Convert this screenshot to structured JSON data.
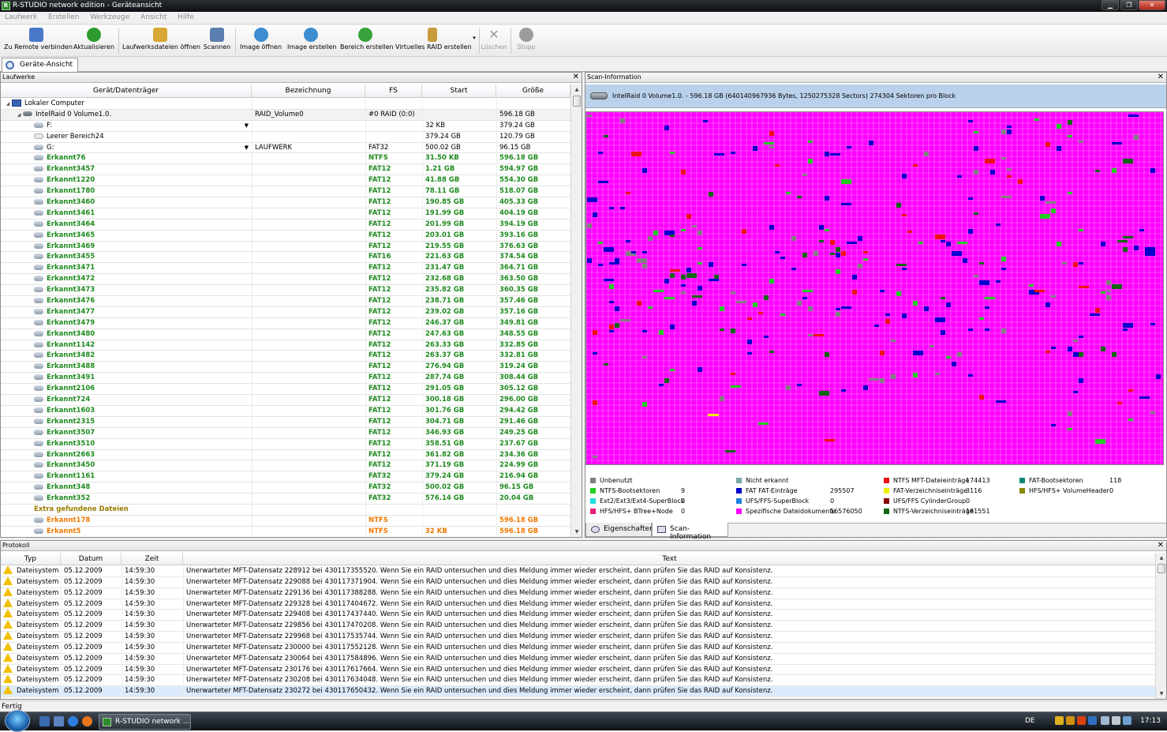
{
  "window": {
    "title": "R-STUDIO network edition - Geräteansicht",
    "buttons": {
      "minimize": "▁",
      "maximize": "❐",
      "close": "✕"
    }
  },
  "menu": [
    "Laufwerk",
    "Erstellen",
    "Werkzeuge",
    "Ansicht",
    "Hilfe"
  ],
  "toolbar": [
    {
      "label": "Zu Remote verbinden",
      "icon": "remote-connect-icon",
      "color": "#4a78c8"
    },
    {
      "label": "Aktualisieren",
      "icon": "refresh-icon",
      "color": "#2e9a2e"
    },
    {
      "label": "Laufwerksdateien öffnen",
      "icon": "open-drive-files-icon",
      "color": "#d8a834"
    },
    {
      "label": "Scannen",
      "icon": "scan-icon",
      "color": "#5a7fb0"
    },
    {
      "label": "Image öffnen",
      "icon": "open-image-icon",
      "color": "#3c8ed0"
    },
    {
      "label": "Image erstellen",
      "icon": "create-image-icon",
      "color": "#3c8ed0"
    },
    {
      "label": "Bereich erstellen",
      "icon": "create-region-icon",
      "color": "#3aa23a"
    },
    {
      "label": "Virtuelles RAID erstellen",
      "icon": "virtual-raid-icon",
      "color": "#c89c3c"
    },
    {
      "label": "Löschen",
      "icon": "delete-icon",
      "color": "#9c9c9c"
    },
    {
      "label": "Stopp",
      "icon": "stop-icon",
      "color": "#9c9c9c"
    }
  ],
  "doctab": "Geräte-Ansicht",
  "drives": {
    "title": "Laufwerke",
    "columns": [
      "Gerät/Datenträger",
      "Bezeichnung",
      "FS",
      "Start",
      "Größe"
    ],
    "rows": [
      {
        "indent": 0,
        "tri": "◢",
        "icon": "computer-icon",
        "name": "Lokaler Computer",
        "label": "",
        "fs": "",
        "start": "",
        "size": "",
        "style": ""
      },
      {
        "indent": 1,
        "tri": "◢",
        "icon": "disk-icon",
        "name": "IntelRaid 0 Volume1.0.",
        "label": "RAID_Volume0",
        "fs": "#0 RAID (0:0)",
        "start": "",
        "size": "596.18 GB",
        "style": "sel"
      },
      {
        "indent": 2,
        "tri": "",
        "icon": "volume-icon",
        "name": "F:",
        "label": "",
        "fs": "",
        "start": "32 KB",
        "size": "379.24 GB",
        "style": "",
        "dd": true
      },
      {
        "indent": 2,
        "tri": "",
        "icon": "empty-space-icon",
        "name": "Leerer Bereich24",
        "label": "",
        "fs": "",
        "start": "379.24 GB",
        "size": "120.79 GB",
        "style": ""
      },
      {
        "indent": 2,
        "tri": "",
        "icon": "volume-icon",
        "name": "G:",
        "label": "LAUFWERK",
        "fs": "FAT32",
        "start": "500.02 GB",
        "size": "96.15 GB",
        "style": "",
        "dd": true
      },
      {
        "indent": 2,
        "tri": "",
        "icon": "volume-icon",
        "name": "Erkannt76",
        "label": "",
        "fs": "NTFS",
        "start": "31.50 KB",
        "size": "596.18 GB",
        "style": "green"
      },
      {
        "indent": 2,
        "tri": "",
        "icon": "volume-icon",
        "name": "Erkannt3457",
        "label": "",
        "fs": "FAT12",
        "start": "1.21 GB",
        "size": "594.97 GB",
        "style": "green"
      },
      {
        "indent": 2,
        "tri": "",
        "icon": "volume-icon",
        "name": "Erkannt1220",
        "label": "",
        "fs": "FAT12",
        "start": "41.88 GB",
        "size": "554.30 GB",
        "style": "green"
      },
      {
        "indent": 2,
        "tri": "",
        "icon": "volume-icon",
        "name": "Erkannt1780",
        "label": "",
        "fs": "FAT12",
        "start": "78.11 GB",
        "size": "518.07 GB",
        "style": "green"
      },
      {
        "indent": 2,
        "tri": "",
        "icon": "volume-icon",
        "name": "Erkannt3460",
        "label": "",
        "fs": "FAT12",
        "start": "190.85 GB",
        "size": "405.33 GB",
        "style": "green"
      },
      {
        "indent": 2,
        "tri": "",
        "icon": "volume-icon",
        "name": "Erkannt3461",
        "label": "",
        "fs": "FAT12",
        "start": "191.99 GB",
        "size": "404.19 GB",
        "style": "green"
      },
      {
        "indent": 2,
        "tri": "",
        "icon": "volume-icon",
        "name": "Erkannt3464",
        "label": "",
        "fs": "FAT12",
        "start": "201.99 GB",
        "size": "394.19 GB",
        "style": "green"
      },
      {
        "indent": 2,
        "tri": "",
        "icon": "volume-icon",
        "name": "Erkannt3465",
        "label": "",
        "fs": "FAT12",
        "start": "203.01 GB",
        "size": "393.16 GB",
        "style": "green"
      },
      {
        "indent": 2,
        "tri": "",
        "icon": "volume-icon",
        "name": "Erkannt3469",
        "label": "",
        "fs": "FAT12",
        "start": "219.55 GB",
        "size": "376.63 GB",
        "style": "green"
      },
      {
        "indent": 2,
        "tri": "",
        "icon": "volume-icon",
        "name": "Erkannt3455",
        "label": "",
        "fs": "FAT16",
        "start": "221.63 GB",
        "size": "374.54 GB",
        "style": "green"
      },
      {
        "indent": 2,
        "tri": "",
        "icon": "volume-icon",
        "name": "Erkannt3471",
        "label": "",
        "fs": "FAT12",
        "start": "231.47 GB",
        "size": "364.71 GB",
        "style": "green"
      },
      {
        "indent": 2,
        "tri": "",
        "icon": "volume-icon",
        "name": "Erkannt3472",
        "label": "",
        "fs": "FAT12",
        "start": "232.68 GB",
        "size": "363.50 GB",
        "style": "green"
      },
      {
        "indent": 2,
        "tri": "",
        "icon": "volume-icon",
        "name": "Erkannt3473",
        "label": "",
        "fs": "FAT12",
        "start": "235.82 GB",
        "size": "360.35 GB",
        "style": "green"
      },
      {
        "indent": 2,
        "tri": "",
        "icon": "volume-icon",
        "name": "Erkannt3476",
        "label": "",
        "fs": "FAT12",
        "start": "238.71 GB",
        "size": "357.46 GB",
        "style": "green"
      },
      {
        "indent": 2,
        "tri": "",
        "icon": "volume-icon",
        "name": "Erkannt3477",
        "label": "",
        "fs": "FAT12",
        "start": "239.02 GB",
        "size": "357.16 GB",
        "style": "green"
      },
      {
        "indent": 2,
        "tri": "",
        "icon": "volume-icon",
        "name": "Erkannt3479",
        "label": "",
        "fs": "FAT12",
        "start": "246.37 GB",
        "size": "349.81 GB",
        "style": "green"
      },
      {
        "indent": 2,
        "tri": "",
        "icon": "volume-icon",
        "name": "Erkannt3480",
        "label": "",
        "fs": "FAT12",
        "start": "247.63 GB",
        "size": "348.55 GB",
        "style": "green"
      },
      {
        "indent": 2,
        "tri": "",
        "icon": "volume-icon",
        "name": "Erkannt1142",
        "label": "",
        "fs": "FAT12",
        "start": "263.33 GB",
        "size": "332.85 GB",
        "style": "green"
      },
      {
        "indent": 2,
        "tri": "",
        "icon": "volume-icon",
        "name": "Erkannt3482",
        "label": "",
        "fs": "FAT12",
        "start": "263.37 GB",
        "size": "332.81 GB",
        "style": "green"
      },
      {
        "indent": 2,
        "tri": "",
        "icon": "volume-icon",
        "name": "Erkannt3488",
        "label": "",
        "fs": "FAT12",
        "start": "276.94 GB",
        "size": "319.24 GB",
        "style": "green"
      },
      {
        "indent": 2,
        "tri": "",
        "icon": "volume-icon",
        "name": "Erkannt3491",
        "label": "",
        "fs": "FAT12",
        "start": "287.74 GB",
        "size": "308.44 GB",
        "style": "green"
      },
      {
        "indent": 2,
        "tri": "",
        "icon": "volume-icon",
        "name": "Erkannt2106",
        "label": "",
        "fs": "FAT12",
        "start": "291.05 GB",
        "size": "305.12 GB",
        "style": "green"
      },
      {
        "indent": 2,
        "tri": "",
        "icon": "volume-icon",
        "name": "Erkannt724",
        "label": "",
        "fs": "FAT12",
        "start": "300.18 GB",
        "size": "296.00 GB",
        "style": "green"
      },
      {
        "indent": 2,
        "tri": "",
        "icon": "volume-icon",
        "name": "Erkannt1603",
        "label": "",
        "fs": "FAT12",
        "start": "301.76 GB",
        "size": "294.42 GB",
        "style": "green"
      },
      {
        "indent": 2,
        "tri": "",
        "icon": "volume-icon",
        "name": "Erkannt2315",
        "label": "",
        "fs": "FAT12",
        "start": "304.71 GB",
        "size": "291.46 GB",
        "style": "green"
      },
      {
        "indent": 2,
        "tri": "",
        "icon": "volume-icon",
        "name": "Erkannt3507",
        "label": "",
        "fs": "FAT12",
        "start": "346.93 GB",
        "size": "249.25 GB",
        "style": "green"
      },
      {
        "indent": 2,
        "tri": "",
        "icon": "volume-icon",
        "name": "Erkannt3510",
        "label": "",
        "fs": "FAT12",
        "start": "358.51 GB",
        "size": "237.67 GB",
        "style": "green"
      },
      {
        "indent": 2,
        "tri": "",
        "icon": "volume-icon",
        "name": "Erkannt2663",
        "label": "",
        "fs": "FAT12",
        "start": "361.82 GB",
        "size": "234.36 GB",
        "style": "green"
      },
      {
        "indent": 2,
        "tri": "",
        "icon": "volume-icon",
        "name": "Erkannt3450",
        "label": "",
        "fs": "FAT12",
        "start": "371.19 GB",
        "size": "224.99 GB",
        "style": "green"
      },
      {
        "indent": 2,
        "tri": "",
        "icon": "volume-icon",
        "name": "Erkannt1161",
        "label": "",
        "fs": "FAT32",
        "start": "379.24 GB",
        "size": "216.94 GB",
        "style": "green"
      },
      {
        "indent": 2,
        "tri": "",
        "icon": "volume-icon",
        "name": "Erkannt348",
        "label": "",
        "fs": "FAT32",
        "start": "500.02 GB",
        "size": "96.15 GB",
        "style": "green"
      },
      {
        "indent": 2,
        "tri": "",
        "icon": "volume-icon",
        "name": "Erkannt352",
        "label": "",
        "fs": "FAT32",
        "start": "576.14 GB",
        "size": "20.04 GB",
        "style": "green"
      },
      {
        "indent": 2,
        "tri": "",
        "icon": "",
        "name": "Extra gefundene Dateien",
        "label": "",
        "fs": "",
        "start": "",
        "size": "",
        "style": "olive"
      },
      {
        "indent": 2,
        "tri": "",
        "icon": "volume-icon",
        "name": "Erkannt178",
        "label": "",
        "fs": "NTFS",
        "start": "",
        "size": "596.18 GB",
        "style": "orange"
      },
      {
        "indent": 2,
        "tri": "",
        "icon": "volume-icon",
        "name": "Erkannt5",
        "label": "",
        "fs": "NTFS",
        "start": "32 KB",
        "size": "596.18 GB",
        "style": "orange"
      }
    ]
  },
  "scan": {
    "title": "Scan-Information",
    "info": "IntelRaid 0 Volume1.0. - 596.18 GB (640140967936 Bytes, 1250275328 Sectors) 274304 Sektoren pro Block",
    "legend": [
      {
        "label": "Unbenutzt",
        "count": "",
        "color": "#808080"
      },
      {
        "label": "NTFS-Bootsektoren",
        "count": "9",
        "color": "#22cc22"
      },
      {
        "label": "Ext2/Ext3/Ext4-SuperBlock",
        "count": "0",
        "color": "#22dddd"
      },
      {
        "label": "HFS/HFS+ BTree+Node",
        "count": "0",
        "color": "#e8207a"
      },
      {
        "label": "Nicht erkannt",
        "count": "",
        "color": "#7aa6a6"
      },
      {
        "label": "FAT FAT-Einträge",
        "count": "295507",
        "color": "#0000cc"
      },
      {
        "label": "UFS/FFS-SuperBlock",
        "count": "0",
        "color": "#2080e0"
      },
      {
        "label": "Spezifische Dateidokumente",
        "count": "16576050",
        "color": "#ff00ff"
      },
      {
        "label": "NTFS MFT-Dateieinträge",
        "count": "174413",
        "color": "#ee1111"
      },
      {
        "label": "FAT-Verzeichniseinträge",
        "count": "3116",
        "color": "#eeee00"
      },
      {
        "label": "UFS/FFS CylinderGroup",
        "count": "0",
        "color": "#880000"
      },
      {
        "label": "NTFS-Verzeichniseinträge",
        "count": "181551",
        "color": "#116611"
      },
      {
        "label": "FAT-Bootsektoren",
        "count": "118",
        "color": "#118877"
      },
      {
        "label": "HFS/HFS+ VolumeHeader",
        "count": "0",
        "color": "#888800"
      }
    ],
    "tabs": [
      "Eigenschaften",
      "Scan-Information"
    ]
  },
  "log": {
    "title": "Protokoll",
    "columns": [
      "Typ",
      "Datum",
      "Zeit",
      "Text"
    ],
    "rows": [
      {
        "type": "Dateisystem",
        "date": "05.12.2009",
        "time": "14:59:30",
        "text": "Unerwarteter MFT-Datensatz 228912 bei 430117355520. Wenn Sie ein RAID untersuchen und dies Meldung immer wieder erscheint, dann prüfen Sie das RAID auf Konsistenz."
      },
      {
        "type": "Dateisystem",
        "date": "05.12.2009",
        "time": "14:59:30",
        "text": "Unerwarteter MFT-Datensatz 229088 bei 430117371904. Wenn Sie ein RAID untersuchen und dies Meldung immer wieder erscheint, dann prüfen Sie das RAID auf Konsistenz."
      },
      {
        "type": "Dateisystem",
        "date": "05.12.2009",
        "time": "14:59:30",
        "text": "Unerwarteter MFT-Datensatz 229136 bei 430117388288. Wenn Sie ein RAID untersuchen und dies Meldung immer wieder erscheint, dann prüfen Sie das RAID auf Konsistenz."
      },
      {
        "type": "Dateisystem",
        "date": "05.12.2009",
        "time": "14:59:30",
        "text": "Unerwarteter MFT-Datensatz 229328 bei 430117404672. Wenn Sie ein RAID untersuchen und dies Meldung immer wieder erscheint, dann prüfen Sie das RAID auf Konsistenz."
      },
      {
        "type": "Dateisystem",
        "date": "05.12.2009",
        "time": "14:59:30",
        "text": "Unerwarteter MFT-Datensatz 229408 bei 430117437440. Wenn Sie ein RAID untersuchen und dies Meldung immer wieder erscheint, dann prüfen Sie das RAID auf Konsistenz."
      },
      {
        "type": "Dateisystem",
        "date": "05.12.2009",
        "time": "14:59:30",
        "text": "Unerwarteter MFT-Datensatz 229856 bei 430117470208. Wenn Sie ein RAID untersuchen und dies Meldung immer wieder erscheint, dann prüfen Sie das RAID auf Konsistenz."
      },
      {
        "type": "Dateisystem",
        "date": "05.12.2009",
        "time": "14:59:30",
        "text": "Unerwarteter MFT-Datensatz 229968 bei 430117535744. Wenn Sie ein RAID untersuchen und dies Meldung immer wieder erscheint, dann prüfen Sie das RAID auf Konsistenz."
      },
      {
        "type": "Dateisystem",
        "date": "05.12.2009",
        "time": "14:59:30",
        "text": "Unerwarteter MFT-Datensatz 230000 bei 430117552128. Wenn Sie ein RAID untersuchen und dies Meldung immer wieder erscheint, dann prüfen Sie das RAID auf Konsistenz."
      },
      {
        "type": "Dateisystem",
        "date": "05.12.2009",
        "time": "14:59:30",
        "text": "Unerwarteter MFT-Datensatz 230064 bei 430117584896. Wenn Sie ein RAID untersuchen und dies Meldung immer wieder erscheint, dann prüfen Sie das RAID auf Konsistenz."
      },
      {
        "type": "Dateisystem",
        "date": "05.12.2009",
        "time": "14:59:30",
        "text": "Unerwarteter MFT-Datensatz 230176 bei 430117617664. Wenn Sie ein RAID untersuchen und dies Meldung immer wieder erscheint, dann prüfen Sie das RAID auf Konsistenz."
      },
      {
        "type": "Dateisystem",
        "date": "05.12.2009",
        "time": "14:59:30",
        "text": "Unerwarteter MFT-Datensatz 230208 bei 430117634048. Wenn Sie ein RAID untersuchen und dies Meldung immer wieder erscheint, dann prüfen Sie das RAID auf Konsistenz."
      },
      {
        "type": "Dateisystem",
        "date": "05.12.2009",
        "time": "14:59:30",
        "text": "Unerwarteter MFT-Datensatz 230272 bei 430117650432. Wenn Sie ein RAID untersuchen und dies Meldung immer wieder erscheint, dann prüfen Sie das RAID auf Konsistenz."
      }
    ]
  },
  "status": "Fertig",
  "taskbar": {
    "task": "R-STUDIO network ...",
    "lang": "DE",
    "clock": "17:13"
  }
}
